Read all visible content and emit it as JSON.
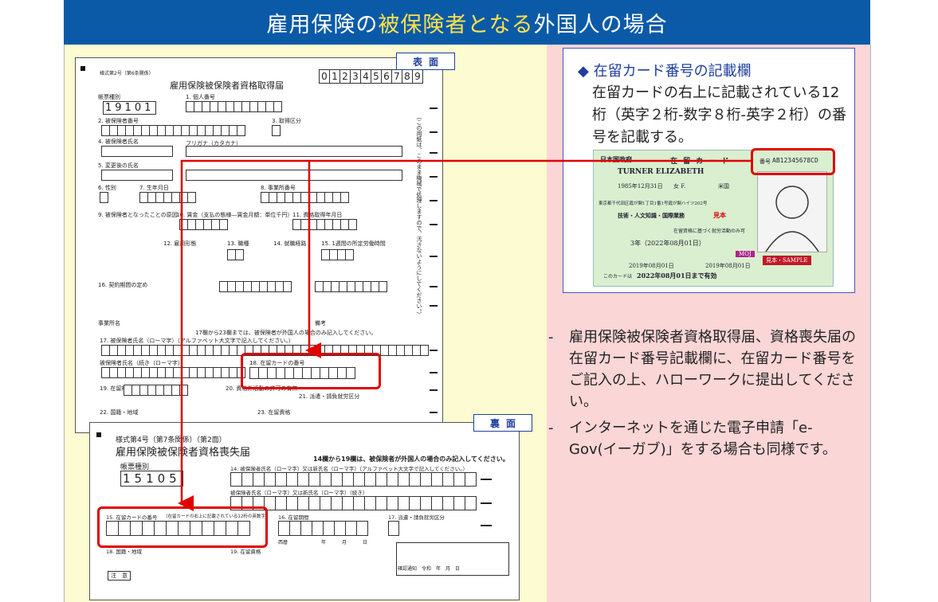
{
  "title": {
    "part1": "雇用保険の",
    "highlight": "被保険者となる",
    "part2": "外国人の場合"
  },
  "front_tag": "表面",
  "back_tag": "裏面",
  "front_form": {
    "form_no": "様式第2号（第6条関係）",
    "title": "雇用保険被保険者資格取得届",
    "side_note": "（この用紙は、このまま機械で処理しますので、汚さないようにしてください。）",
    "top_digits_label": "帳票種別",
    "top_digits": "0123456789",
    "label_01": "帳票種別",
    "code": "19101",
    "label_1": "1. 個人番号",
    "label_2": "2. 被保険者番号",
    "label_3": "3. 取得区分",
    "label_4": "4. 被保険者氏名",
    "label_furigana": "フリガナ（カタカナ）",
    "label_5": "5. 変更後の氏名",
    "label_6": "6. 性別",
    "label_7": "7. 生年月日",
    "label_8": "8. 事業所番号",
    "label_9": "9. 被保険者となったことの原因",
    "label_10": "10. 賃金（支払の態様―賃金月額：単位千円）",
    "label_11": "11. 資格取得年月日",
    "label_12": "12. 雇用形態",
    "label_13": "13. 職種",
    "label_14": "14. 就職経路",
    "label_15": "15. 1週間の所定労働時間",
    "label_16": "16. 契約期間の定め",
    "label_office": "事業所名",
    "label_remarks": "備考",
    "notice_17_23": "17欄から23欄までは、被保険者が外国人の場合のみ記入してください。",
    "label_17": "17. 被保険者氏名（ローマ字）（アルファベット大文字で記入してください。）",
    "label_17b": "被保険者氏名（続き（ローマ字））",
    "label_18": "18. 在留カードの番号",
    "label_19": "19. 在留期間",
    "label_20": "20. 資格外活動の許可の有無",
    "label_21": "21. 派遣・請負就労区分",
    "label_22": "22. 国籍・地域",
    "label_23": "23. 在留資格"
  },
  "back_form": {
    "form_no": "様式第4号（第7条関係）（第2面）",
    "title": "雇用保険被保険者資格喪失届",
    "notice": "14欄から19欄は、被保険者が外国人の場合のみ記入してください。",
    "label_type": "帳票種別",
    "code": "15105",
    "label_14": "14. 被保険者氏名（ローマ字）又は新氏名（ローマ字）（アルファベット大文字で記入してください。）",
    "label_14b": "被保険者氏名（ローマ字）又は新氏名（ローマ字）（続き）",
    "label_15": "15. 在留カードの番号",
    "label_15_note": "（在留カードの右上に記載されている12桁の英数字）",
    "label_16": "16. 在留期間",
    "label_17": "17. 派遣・請負就労区分",
    "label_18": "18. 国籍・地域",
    "label_19": "19. 在留資格",
    "label_year": "西暦",
    "label_y": "年",
    "label_m": "月",
    "label_d": "日",
    "notes_title": "注　意",
    "confirm": "確認通知　令和　年　月　日"
  },
  "info": {
    "title": "在留カード番号の記載欄",
    "text": "在留カードの右上に記載されている12桁（英字２桁‐数字８桁‐英字２桁）の番号を記載する。"
  },
  "card": {
    "country": "日本国政府",
    "card_title": "在 留 カ ー ド",
    "number_label": "番号",
    "number": "AB12345678CD",
    "name": "TURNER ELIZABETH",
    "birth": "1985年12月31日",
    "sex": "女 F.",
    "nationality": "米国",
    "address": "東京都千代田区霞が関1丁目1番1号霞が関ハイツ202号",
    "status": "技術・人文知識・国際業務",
    "sample_stamp": "見本",
    "work_limit": "在留資格に基づく就労活動のみ可",
    "period": "3年（2022年08月01日）",
    "moj": "MOJ",
    "permit_date": "2019年08月01日",
    "issue_date": "2019年08月01日",
    "valid_label": "このカードは",
    "valid_until": "2022年08月01日まで有効",
    "sample": "見本・SAMPLE"
  },
  "bullets": [
    "雇用保険被保険者資格取得届、資格喪失届の在留カード番号記載欄に、在留カード番号をご記入の上、ハローワークに提出してください。",
    "インターネットを通じた電子申請「e-Gov(イーガブ)」をする場合も同様です。"
  ],
  "bullet_marker": "-",
  "diamond": "◆",
  "colors": {
    "title_bg": "#0b5aa8",
    "highlight": "#ffe24a",
    "arrow": "#e00000",
    "left_bg": "#fdfbd2",
    "right_bg": "#fad6d6"
  }
}
